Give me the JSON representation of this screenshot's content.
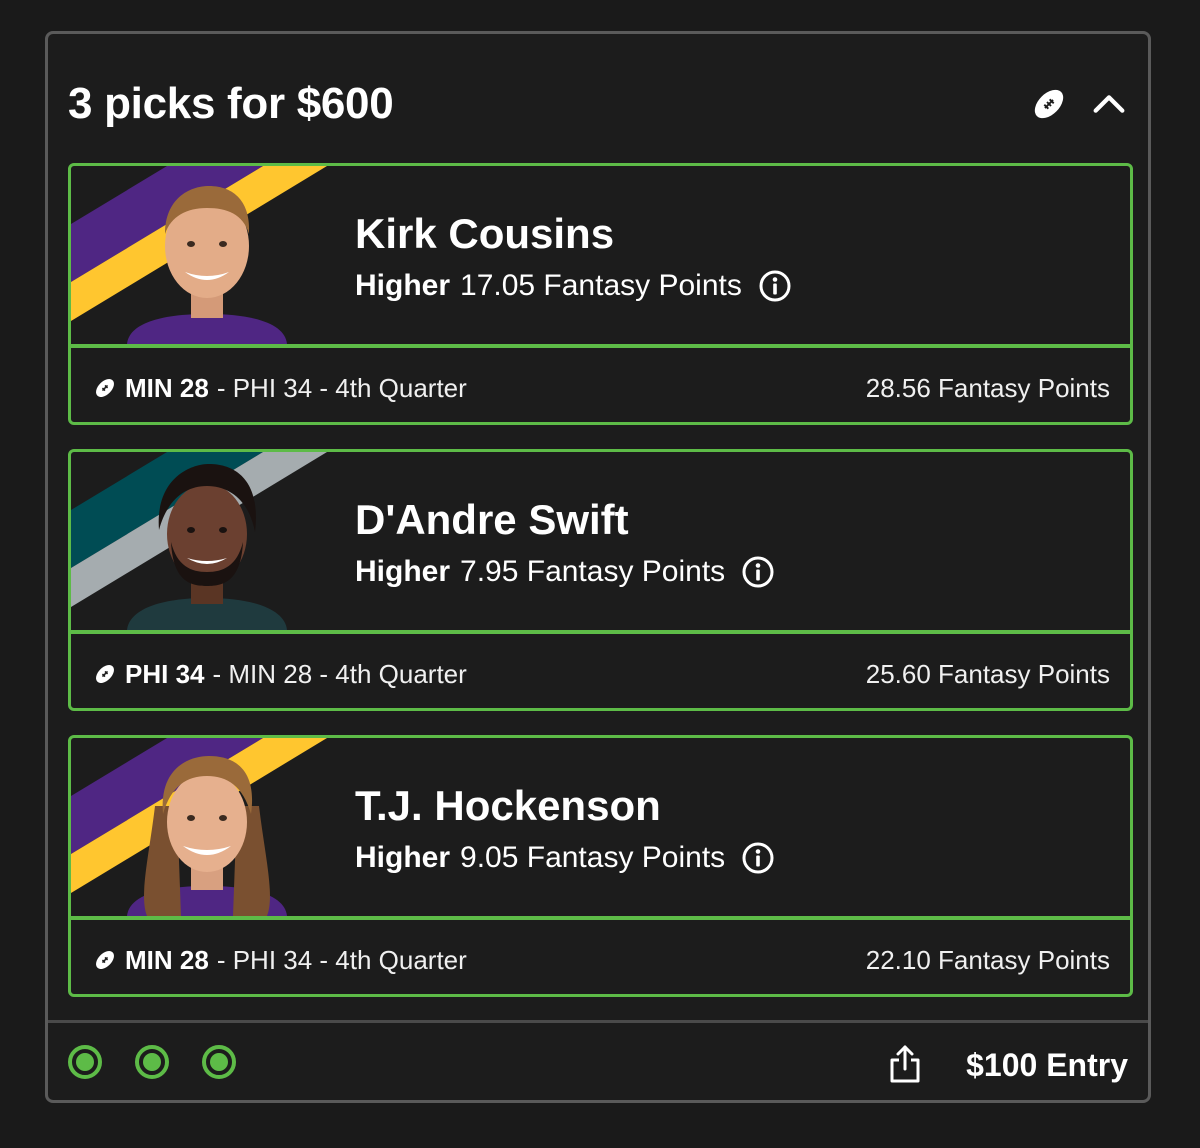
{
  "entry": {
    "title": "3 picks for $600",
    "sport_icon": "football-icon",
    "collapse_icon": "chevron-up-icon",
    "entry_label": "$100 Entry",
    "share_icon": "share-icon",
    "progress_dots": [
      "success",
      "success",
      "success"
    ]
  },
  "colors": {
    "accent_green": "#5dbb47",
    "background": "#1a1a1a",
    "vikings_purple": "#4f2683",
    "vikings_gold": "#ffc62f",
    "eagles_green": "#004c54",
    "eagles_silver": "#a5acaf"
  },
  "picks": [
    {
      "player": "Kirk Cousins",
      "direction": "Higher",
      "line": "17.05 Fantasy Points",
      "team": "MIN 28",
      "game": "- PHI 34 - 4th Quarter",
      "result": "28.56 Fantasy Points",
      "stripe_colors": [
        "#4f2683",
        "#ffc62f"
      ]
    },
    {
      "player": "D'Andre Swift",
      "direction": "Higher",
      "line": "7.95 Fantasy Points",
      "team": "PHI 34",
      "game": "- MIN 28 - 4th Quarter",
      "result": "25.60 Fantasy Points",
      "stripe_colors": [
        "#004c54",
        "#a5acaf"
      ]
    },
    {
      "player": "T.J. Hockenson",
      "direction": "Higher",
      "line": "9.05 Fantasy Points",
      "team": "MIN 28",
      "game": "- PHI 34 - 4th Quarter",
      "result": "22.10 Fantasy Points",
      "stripe_colors": [
        "#4f2683",
        "#ffc62f"
      ]
    }
  ]
}
